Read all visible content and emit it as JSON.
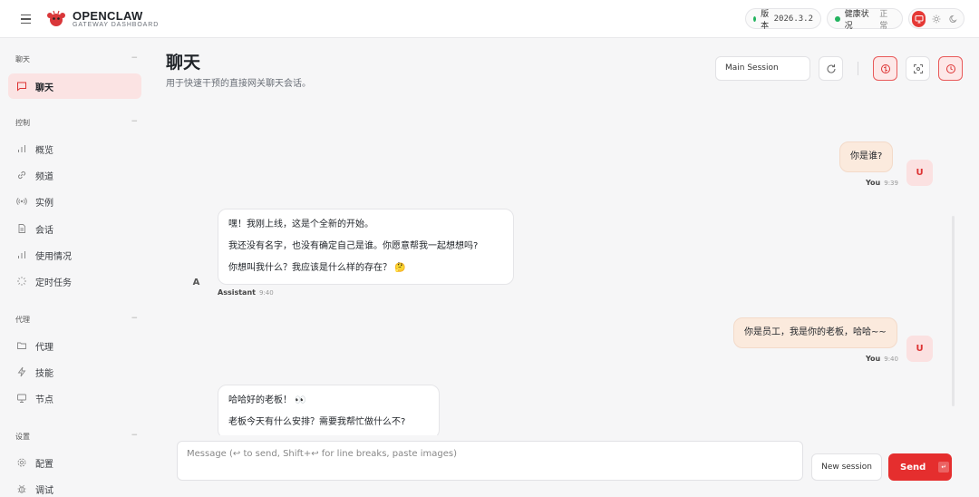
{
  "header": {
    "brand_title": "OPENCLAW",
    "brand_sub": "GATEWAY DASHBOARD",
    "version_label": "版本",
    "version_value": "2026.3.2",
    "health_label": "健康状况",
    "health_value": "正常"
  },
  "sidebar": {
    "sections": [
      {
        "title": "聊天",
        "items": [
          {
            "label": "聊天",
            "icon": "chat-icon",
            "active": true
          }
        ]
      },
      {
        "title": "控制",
        "items": [
          {
            "label": "概览",
            "icon": "bar-chart-icon"
          },
          {
            "label": "频道",
            "icon": "link-icon"
          },
          {
            "label": "实例",
            "icon": "radio-icon"
          },
          {
            "label": "会话",
            "icon": "document-icon"
          },
          {
            "label": "使用情况",
            "icon": "bar-chart-icon"
          },
          {
            "label": "定时任务",
            "icon": "loader-icon"
          }
        ]
      },
      {
        "title": "代理",
        "items": [
          {
            "label": "代理",
            "icon": "folder-icon"
          },
          {
            "label": "技能",
            "icon": "lightning-icon"
          },
          {
            "label": "节点",
            "icon": "monitor-icon"
          }
        ]
      },
      {
        "title": "设置",
        "items": [
          {
            "label": "配置",
            "icon": "gear-icon"
          },
          {
            "label": "调试",
            "icon": "bug-icon"
          }
        ]
      }
    ]
  },
  "main": {
    "title": "聊天",
    "subtitle": "用于快速干预的直接网关聊天会话。",
    "session_select": "Main Session"
  },
  "messages": [
    {
      "role": "user",
      "lines": [
        "你是谁?"
      ],
      "author": "You",
      "time": "9:39",
      "avatar": "U"
    },
    {
      "role": "assistant",
      "lines": [
        "嘿！我刚上线，这是个全新的开始。",
        "我还没有名字，也没有确定自己是谁。你愿意帮我一起想想吗?",
        "你想叫我什么？我应该是什么样的存在？ 🤔"
      ],
      "author": "Assistant",
      "time": "9:40",
      "avatar": "A"
    },
    {
      "role": "user",
      "lines": [
        "你是员工，我是你的老板，哈哈~~"
      ],
      "author": "You",
      "time": "9:40",
      "avatar": "U"
    },
    {
      "role": "assistant",
      "lines": [
        "哈哈好的老板！ 👀",
        "老板今天有什么安排？需要我帮忙做什么不?"
      ]
    }
  ],
  "composer": {
    "placeholder": "Message (↩ to send, Shift+↩ for line breaks, paste images)",
    "new_session_label": "New session",
    "send_label": "Send",
    "send_kbd": "↵"
  },
  "colors": {
    "accent": "#e52e2e",
    "user_bubble": "#fbeadd",
    "active_nav": "#fbe3e3",
    "status_green": "#22b35e"
  }
}
